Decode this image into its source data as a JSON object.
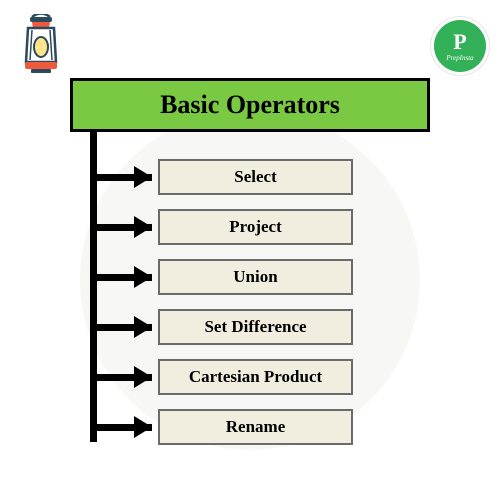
{
  "brand": {
    "letter": "P",
    "subtitle": "PrepInsta"
  },
  "title": "Basic Operators",
  "operators": [
    {
      "label": "Select"
    },
    {
      "label": "Project"
    },
    {
      "label": "Union"
    },
    {
      "label": "Set Difference"
    },
    {
      "label": "Cartesian Product"
    },
    {
      "label": "Rename"
    }
  ],
  "colors": {
    "title_fill": "#7ac943",
    "box_fill": "#f2eedf",
    "badge": "#32b158"
  }
}
